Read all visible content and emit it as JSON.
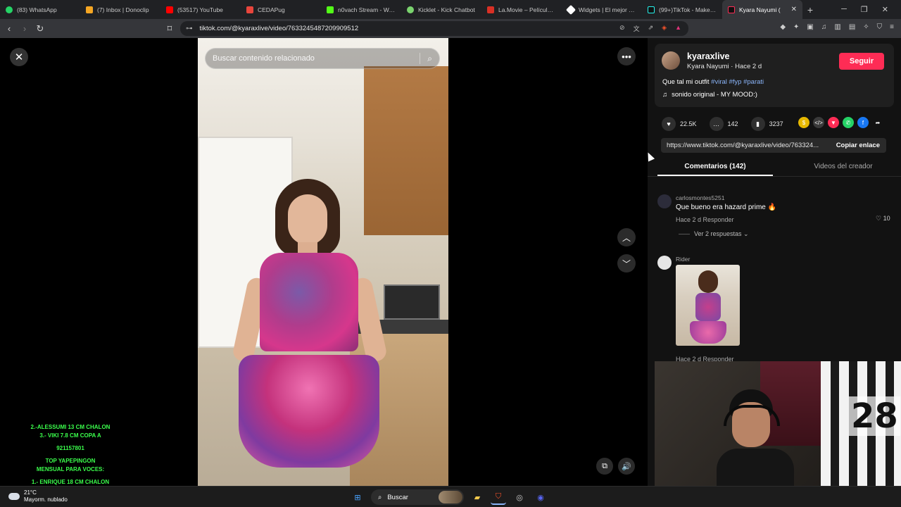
{
  "browser": {
    "tabs": [
      {
        "title": "(83) WhatsApp",
        "color": "#25d366"
      },
      {
        "title": "(7) Inbox | Donoclip",
        "color": "#f5a623"
      },
      {
        "title": "(53517) YouTube",
        "color": "#ff0000"
      },
      {
        "title": "CEDAPug",
        "color": "#e8453c"
      },
      {
        "title": "n0vach Stream - Watch",
        "color": "#53fc18"
      },
      {
        "title": "Kicklet - Kick Chatbot",
        "color": "#7ad36e"
      },
      {
        "title": "La.Movie – Películas, S",
        "color": "#d93025"
      },
      {
        "title": "Widgets | El mejor soft",
        "color": "#ffffff"
      },
      {
        "title": "(99+)TikTok - Make Yo",
        "color": "#111111"
      },
      {
        "title": "Kyara Nayumi (",
        "color": "#111111",
        "active": true
      }
    ],
    "new_tab": "+",
    "url": "tiktok.com/@kyaraxlive/video/7633245487209909512"
  },
  "video": {
    "search_placeholder": "Buscar contenido relacionado",
    "close": "✕",
    "more": "•••",
    "up": "︿",
    "down": "﹀"
  },
  "post": {
    "username": "kyaraxlive",
    "subtitle": "Kyara Nayumi · Hace 2 d",
    "follow_label": "Seguir",
    "caption_text": "Que tal mi outfit ",
    "hashtags": "#viral #fyp #parati",
    "music": "sonido original - MY MOOD:)",
    "likes": "22.5K",
    "comments": "142",
    "saves": "3237",
    "link": "https://www.tiktok.com/@kyaraxlive/video/763324...",
    "copy_label": "Copiar enlace"
  },
  "tabs": {
    "comments": "Comentarios (142)",
    "creator": "Videos del creador"
  },
  "comments": [
    {
      "user": "carlosmontes5251",
      "text": "Que bueno era hazard prime 🔥",
      "meta": "Hace 2 d    Responder",
      "likes": "♡ 10",
      "replies": "Ver 2 respuestas ⌄"
    },
    {
      "user": "Rider",
      "meta": "Hace 2 d    Responder"
    }
  ],
  "overlay": {
    "lines": [
      "2.-ALESSUMI 13 CM CHALON",
      "3.- VIKI 7.8 CM COPA A",
      "921157801",
      "TOP YAPEPINGON",
      "MENSUAL PARA VOCES:",
      "1.- ENRIQUE 18 CM CHALON"
    ]
  },
  "webcam": {
    "jersey_number": "28"
  },
  "taskbar": {
    "temp": "21°C",
    "weather": "Mayorm. nublado",
    "search_label": "Buscar"
  },
  "colors": {
    "accent": "#fe2c55",
    "hashtag": "#8ab4f8",
    "overlay": "#3bff4c"
  }
}
